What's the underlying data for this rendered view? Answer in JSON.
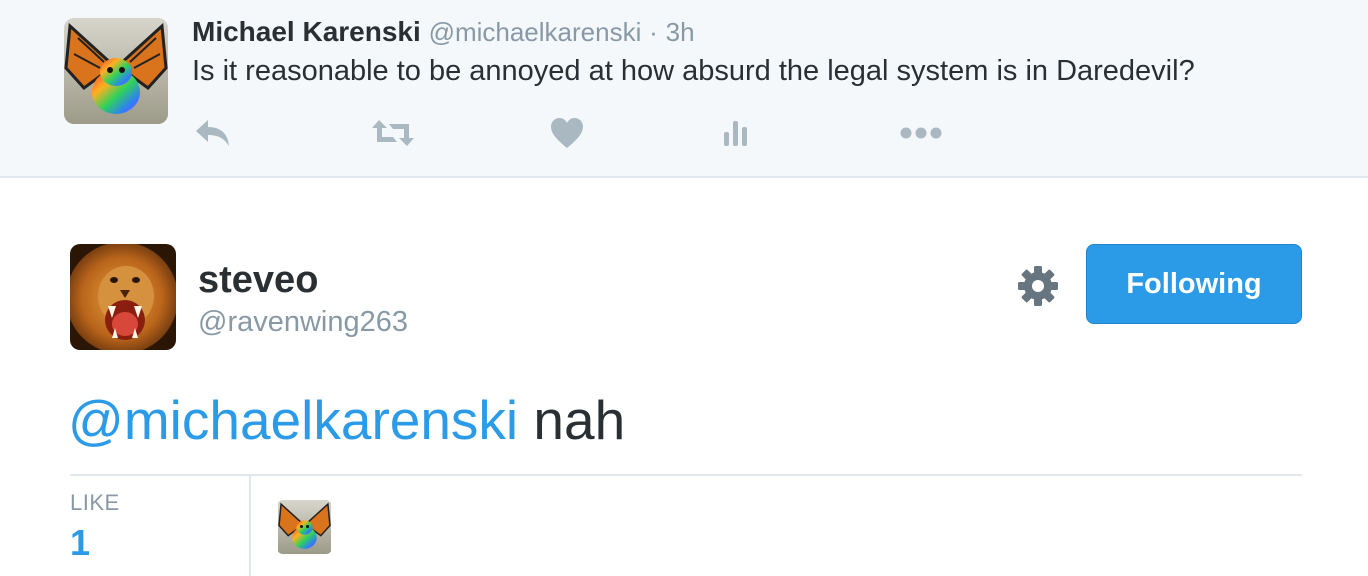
{
  "parent_tweet": {
    "author_name": "Michael Karenski",
    "author_handle": "@michaelkarenski",
    "separator": "·",
    "time": "3h",
    "text": "Is it reasonable to be annoyed at how absurd the legal system is in Daredevil?",
    "actions": [
      "reply-icon",
      "retweet-icon",
      "like-icon",
      "analytics-icon",
      "more-icon"
    ]
  },
  "tweet": {
    "display_name": "steveo",
    "username": "@ravenwing263",
    "follow_label": "Following",
    "mention": "@michaelkarenski",
    "body": " nah",
    "stats": {
      "like_label": "LIKE",
      "like_count": "1"
    }
  },
  "colors": {
    "accent": "#2b9be8",
    "muted": "#8899a6",
    "text": "#292f33",
    "parent_background": "#f5f8fa"
  }
}
